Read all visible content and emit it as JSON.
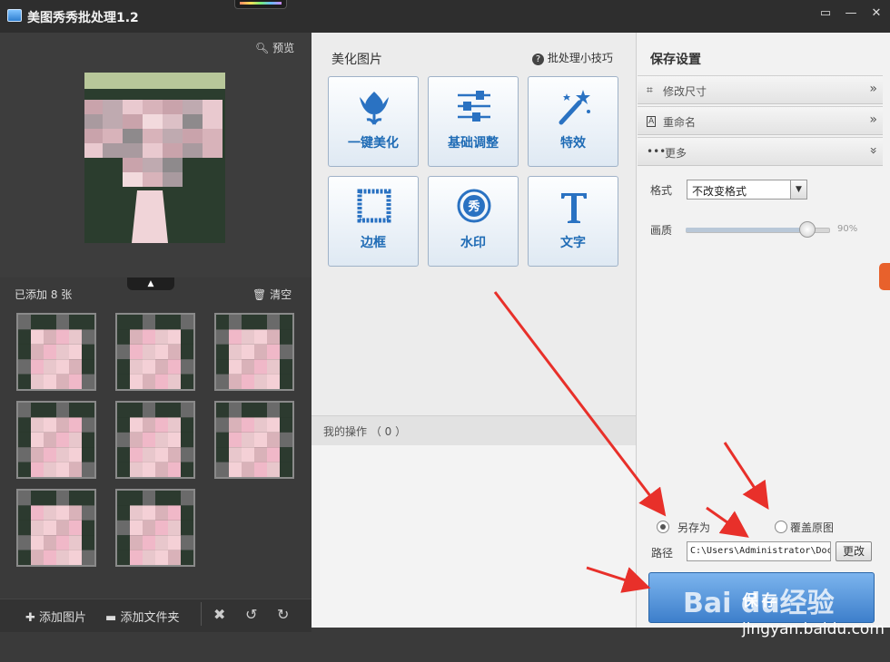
{
  "window": {
    "title": "美图秀秀批处理1.2",
    "buttons": {
      "feedback": "▭",
      "minimize": "—",
      "close": "✕"
    }
  },
  "left_panel": {
    "preview_label": "预览",
    "added_count": "已添加 8 张",
    "clear_label": "清空",
    "thumbnails": 8,
    "bottom": {
      "add_image": "添加图片",
      "add_folder": "添加文件夹"
    }
  },
  "middle_panel": {
    "title": "美化图片",
    "tips": "批处理小技巧",
    "tools": [
      {
        "label": "一键美化",
        "icon": "tulip-icon"
      },
      {
        "label": "基础调整",
        "icon": "sliders-icon"
      },
      {
        "label": "特效",
        "icon": "magic-wand-icon"
      },
      {
        "label": "边框",
        "icon": "frame-icon"
      },
      {
        "label": "水印",
        "icon": "watermark-icon"
      },
      {
        "label": "文字",
        "icon": "text-icon"
      }
    ],
    "ops_label": "我的操作 （ 0 ）"
  },
  "right_panel": {
    "title": "保存设置",
    "accordion": [
      {
        "label": "修改尺寸",
        "icon": "crop-icon",
        "chevron": "»"
      },
      {
        "label": "重命名",
        "icon": "rename-icon",
        "chevron": "»"
      },
      {
        "label": "更多",
        "icon": "more-icon",
        "chevron": "»"
      }
    ],
    "format_label": "格式",
    "format_value": "不改变格式",
    "quality_label": "画质",
    "quality_value": "90%",
    "quality_fraction": 0.9,
    "save_as": "另存为",
    "overwrite": "覆盖原图",
    "path_label": "路径",
    "path_value": "C:\\Users\\Administrator\\Documents",
    "change": "更改",
    "save": "保存"
  },
  "watermark": {
    "logo": "Bai du经验",
    "url": "jingyan.baidu.com"
  },
  "colors": {
    "accent": "#3d7fcb",
    "annotation": "#e8302a"
  }
}
